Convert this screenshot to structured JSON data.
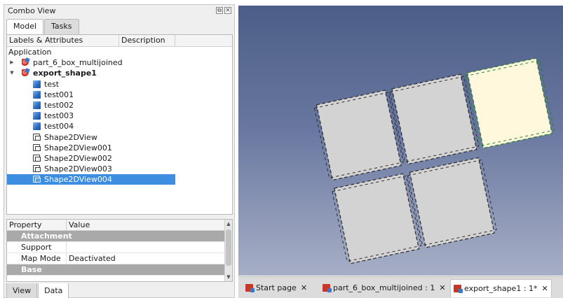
{
  "combo": {
    "title": "Combo View",
    "tabs": [
      "Model",
      "Tasks"
    ],
    "tree_header": {
      "labels": "Labels & Attributes",
      "description": "Description"
    },
    "tree": [
      {
        "label": "Application",
        "icon": "none"
      },
      {
        "label": "part_6_box_multijoined",
        "icon": "part-icon",
        "expanded": false
      },
      {
        "label": "export_shape1",
        "icon": "part-icon",
        "expanded": true,
        "bold": true
      },
      {
        "label": "test",
        "icon": "box-icon"
      },
      {
        "label": "test001",
        "icon": "box-icon"
      },
      {
        "label": "test002",
        "icon": "box-icon"
      },
      {
        "label": "test003",
        "icon": "box-icon"
      },
      {
        "label": "test004",
        "icon": "box-icon"
      },
      {
        "label": "Shape2DView",
        "icon": "shape2d-icon"
      },
      {
        "label": "Shape2DView001",
        "icon": "shape2d-icon"
      },
      {
        "label": "Shape2DView002",
        "icon": "shape2d-icon"
      },
      {
        "label": "Shape2DView003",
        "icon": "shape2d-icon"
      },
      {
        "label": "Shape2DView004",
        "icon": "shape2d-icon",
        "selected": true
      }
    ],
    "properties": {
      "header": {
        "property": "Property",
        "value": "Value"
      },
      "rows": [
        {
          "type": "group",
          "label": "Attachment"
        },
        {
          "type": "prop",
          "label": "Support",
          "value": ""
        },
        {
          "type": "prop",
          "label": "Map Mode",
          "value": "Deactivated"
        },
        {
          "type": "group",
          "label": "Base"
        }
      ]
    },
    "bottom_tabs": [
      "View",
      "Data"
    ]
  },
  "doc_tabs": [
    {
      "label": "Start page"
    },
    {
      "label": "part_6_box_multijoined : 1"
    },
    {
      "label": "export_shape1 : 1*",
      "active": true
    }
  ],
  "colors": {
    "selection": "#3d8ee0",
    "view_top": "#4c5e87",
    "view_bottom": "#a7afc6",
    "panel_fill": "#d3d3d3",
    "panel_selected": "#fff8dc"
  },
  "icons": {
    "title_buttons": [
      "float-icon",
      "close-icon"
    ],
    "tab_close": "close-icon"
  }
}
